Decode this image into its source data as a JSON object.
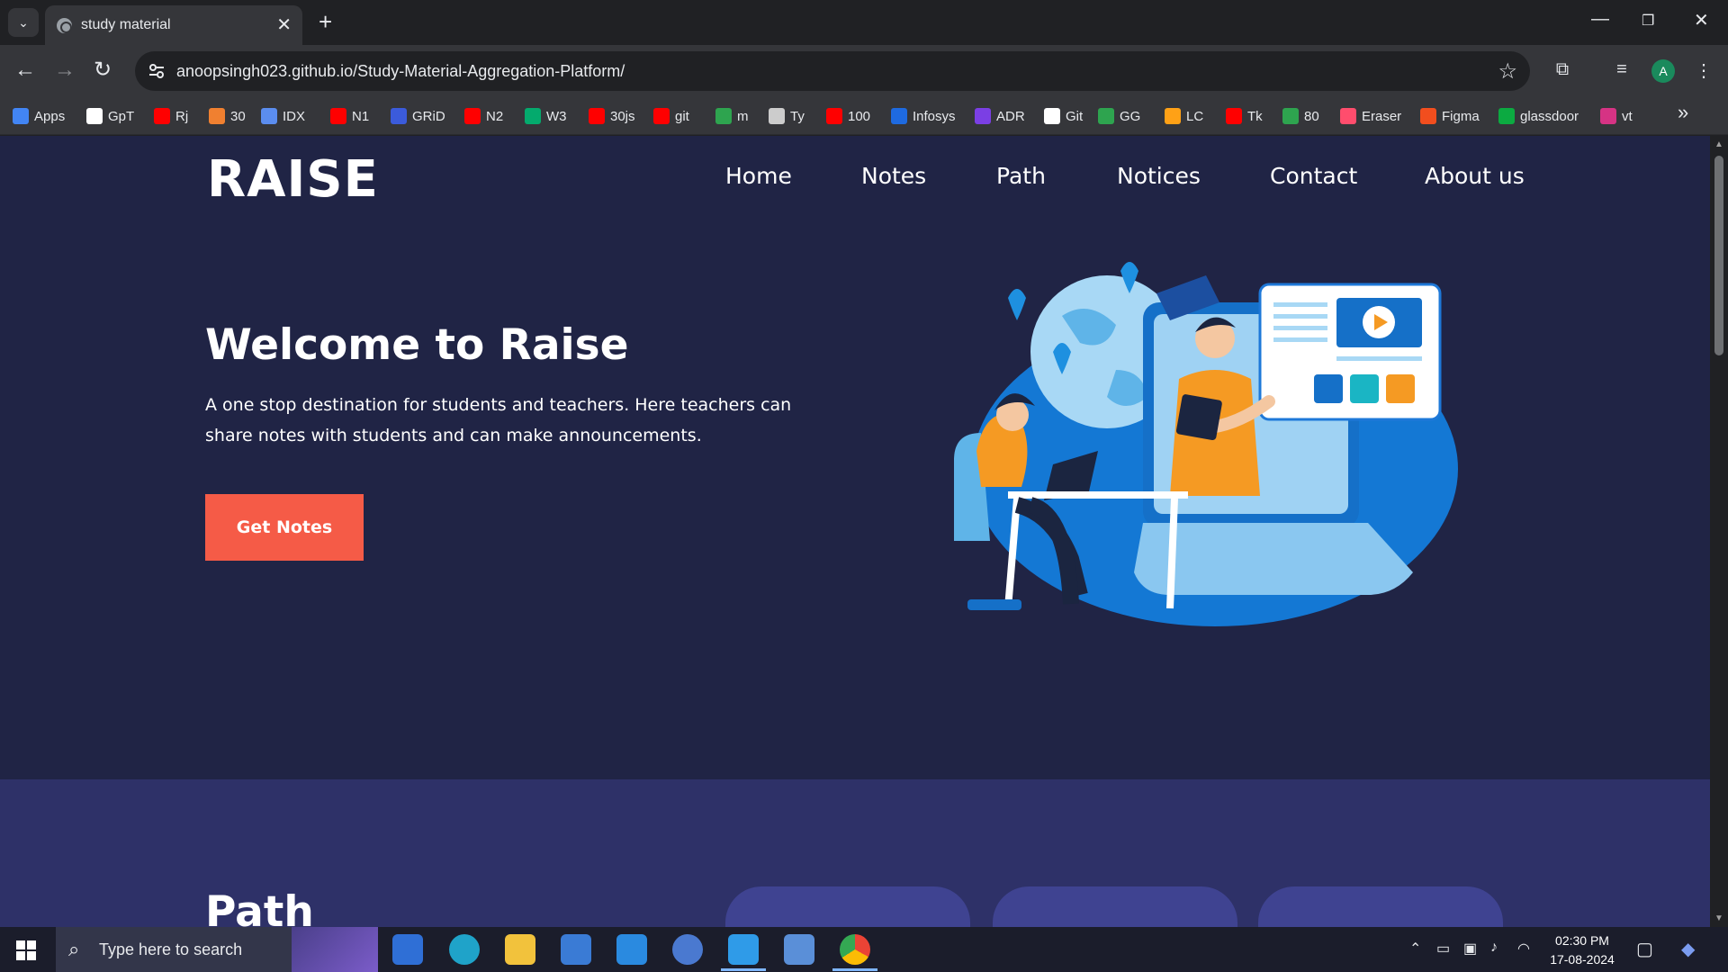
{
  "browser": {
    "tab_title": "study material",
    "url": "anoopsingh023.github.io/Study-Material-Aggregation-Platform/",
    "profile_initial": "A",
    "bookmarks": [
      {
        "label": "Apps",
        "color": "#4285f4"
      },
      {
        "label": "GpT",
        "color": "#ffffff"
      },
      {
        "label": "Rj",
        "color": "#ff0000"
      },
      {
        "label": "30",
        "color": "#f08030"
      },
      {
        "label": "IDX",
        "color": "#5b8def"
      },
      {
        "label": "N1",
        "color": "#ff0000"
      },
      {
        "label": "GRiD",
        "color": "#3b5bdb"
      },
      {
        "label": "N2",
        "color": "#ff0000"
      },
      {
        "label": "W3",
        "color": "#04aa6d"
      },
      {
        "label": "30js",
        "color": "#ff0000"
      },
      {
        "label": "git",
        "color": "#ff0000"
      },
      {
        "label": "m",
        "color": "#2ea44f"
      },
      {
        "label": "Ty",
        "color": "#cccccc"
      },
      {
        "label": "100",
        "color": "#ff0000"
      },
      {
        "label": "Infosys",
        "color": "#1e6ae0"
      },
      {
        "label": "ADR",
        "color": "#7b3fe4"
      },
      {
        "label": "Git",
        "color": "#ffffff"
      },
      {
        "label": "GG",
        "color": "#2ea44f"
      },
      {
        "label": "LC",
        "color": "#ffa116"
      },
      {
        "label": "Tk",
        "color": "#ff0000"
      },
      {
        "label": "80",
        "color": "#2ea44f"
      },
      {
        "label": "Eraser",
        "color": "#ff4d6d"
      },
      {
        "label": "Figma",
        "color": "#f24e1e"
      },
      {
        "label": "glassdoor",
        "color": "#0caa41"
      },
      {
        "label": "vt",
        "color": "#d63384"
      }
    ]
  },
  "site": {
    "logo": "RAISE",
    "nav": [
      "Home",
      "Notes",
      "Path",
      "Notices",
      "Contact",
      "About us"
    ],
    "hero": {
      "title": "Welcome to Raise",
      "text": "A one stop destination for students and teachers. Here teachers can share notes with students and can make announcements.",
      "cta": "Get Notes"
    },
    "path_section": {
      "title": "Path"
    },
    "colors": {
      "background": "#202445",
      "section2": "#2e3168",
      "card": "#3f4391",
      "cta": "#f55b47"
    }
  },
  "taskbar": {
    "search_placeholder": "Type here to search",
    "time": "02:30 PM",
    "date": "17-08-2024",
    "apps": [
      "file-explorer-window-icon",
      "edge-icon",
      "folder-icon",
      "store-icon",
      "mail-icon",
      "imo-icon",
      "vscode-icon",
      "remote-desktop-icon",
      "chrome-icon"
    ]
  }
}
